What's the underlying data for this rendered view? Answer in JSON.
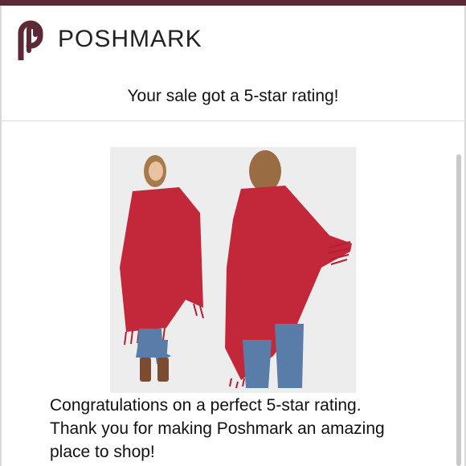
{
  "brand": {
    "name": "POSHMARK",
    "logo_icon": "poshmark-p-logo-icon",
    "color": "#5b2a36"
  },
  "headline": "Your sale got a 5-star rating!",
  "product": {
    "images": [
      "red-fringe-poncho-front-photo",
      "red-fringe-poncho-back-photo"
    ],
    "accent": "#c0283a"
  },
  "message": {
    "line1": "Congratulations on a perfect 5-star rating.",
    "line2": "Thank you for making Poshmark an amazing",
    "line3": "place to shop!"
  }
}
